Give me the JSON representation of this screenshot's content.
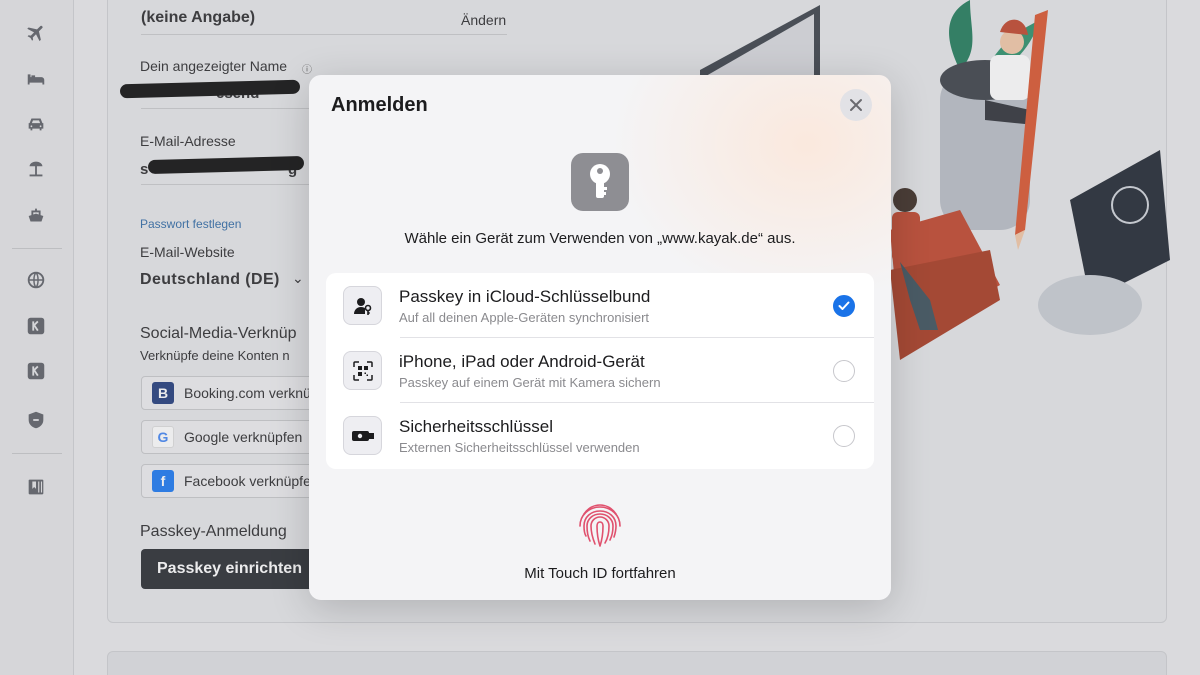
{
  "profile": {
    "gender_value": "(keine Angabe)",
    "change_label": "Ändern",
    "display_name_label": "Dein angezeigter Name",
    "display_name_value_suffix": "esend",
    "email_label": "E-Mail-Adresse",
    "email_value_start": "s",
    "email_value_end": "g",
    "password_link": "Passwort festlegen",
    "website_label": "E-Mail-Website",
    "website_value": "Deutschland (DE)",
    "social_heading": "Social-Media-Verknüp",
    "social_desc": "Verknüpfe deine Konten n",
    "social_buttons": [
      {
        "label": "Booking.com verknüpfen",
        "logo": "B"
      },
      {
        "label": "Google verknüpfen",
        "logo": "G"
      },
      {
        "label": "Facebook verknüpfen",
        "logo": "f"
      }
    ],
    "passkey_heading": "Passkey-Anmeldung",
    "passkey_button": "Passkey einrichten"
  },
  "sidebar": {
    "icons": [
      "plane-icon",
      "bed-icon",
      "car-icon",
      "beach-icon",
      "ship-icon",
      "globe-icon",
      "kayak-k-icon",
      "kayak-k-icon-2",
      "shield-icon",
      "bookmark-icon"
    ]
  },
  "modal": {
    "title": "Anmelden",
    "prompt": "Wähle ein Gerät zum Verwenden von „www.kayak.de“ aus.",
    "options": [
      {
        "title": "Passkey in iCloud-Schlüsselbund",
        "subtitle": "Auf all deinen Apple-Geräten synchronisiert",
        "selected": true,
        "icon": "person-key-icon"
      },
      {
        "title": "iPhone, iPad oder Android-Gerät",
        "subtitle": "Passkey auf einem Gerät mit Kamera sichern",
        "selected": false,
        "icon": "qr-code-icon"
      },
      {
        "title": "Sicherheitsschlüssel",
        "subtitle": "Externen Sicherheitsschlüssel verwenden",
        "selected": false,
        "icon": "usb-key-icon"
      }
    ],
    "touch_id_label": "Mit Touch ID fortfahren"
  },
  "colors": {
    "accent": "#1a73e8",
    "dark_button": "#262a2f",
    "key_tile": "#8e8e93"
  }
}
